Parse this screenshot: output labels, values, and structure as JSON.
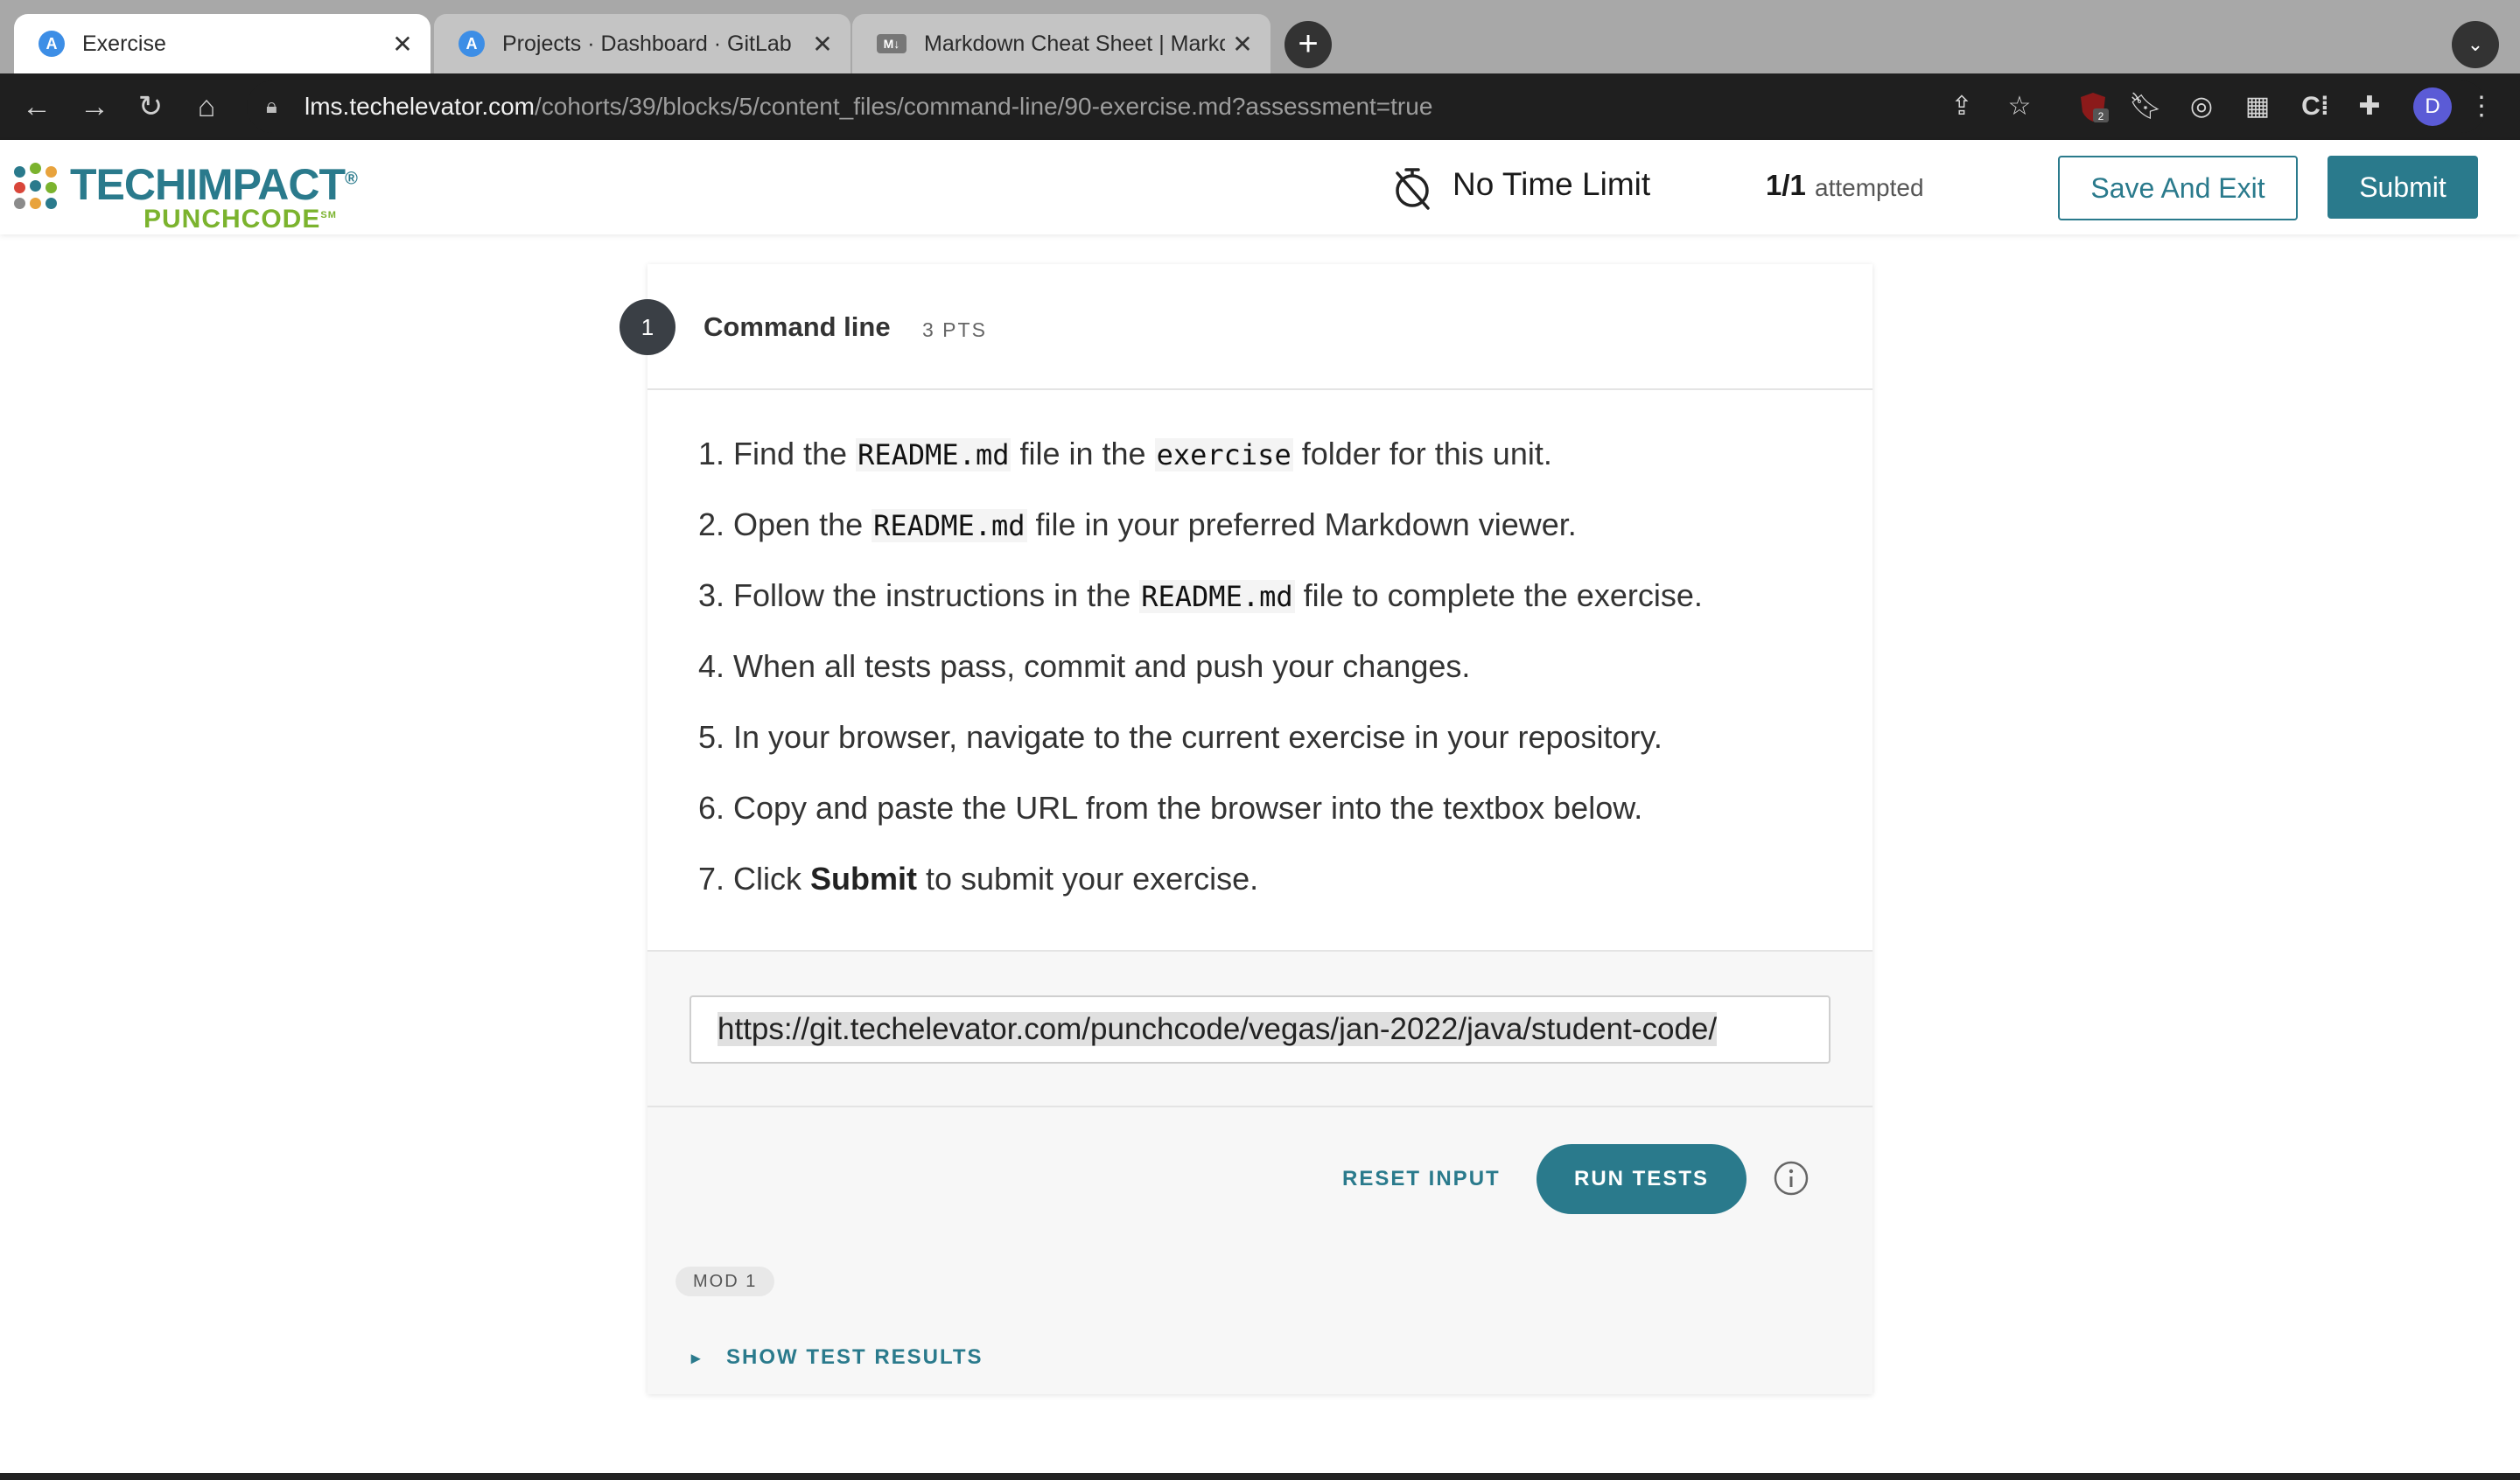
{
  "browser": {
    "tabs": [
      {
        "title": "Exercise",
        "favicon": "A",
        "active": true
      },
      {
        "title": "Projects · Dashboard · GitLab",
        "favicon": "A",
        "active": false
      },
      {
        "title": "Markdown Cheat Sheet | Markd",
        "favicon": "M↓",
        "active": false
      }
    ],
    "url": {
      "host": "lms.techelevator.com",
      "path": "/cohorts/39/blocks/5/content_files/command-line/90-exercise.md?assessment=true"
    },
    "profile_initial": "D",
    "extension_badge": "2"
  },
  "header": {
    "logo_line1": "TECHIMPACT",
    "logo_line1_mark": "®",
    "logo_line2": "PUNCHCODE",
    "logo_line2_mark": "SM",
    "time_limit": "No Time Limit",
    "attempt_count": "1/1",
    "attempt_label": "attempted",
    "save_exit_label": "Save And Exit",
    "submit_label": "Submit"
  },
  "question": {
    "number": "1",
    "title": "Command line",
    "points": "3 PTS",
    "steps": [
      {
        "num": "1.",
        "parts": [
          "Find the ",
          "README.md",
          " file in the ",
          "exercise",
          " folder for this unit."
        ]
      },
      {
        "num": "2.",
        "parts": [
          "Open the ",
          "README.md",
          " file in your preferred Markdown viewer."
        ]
      },
      {
        "num": "3.",
        "parts": [
          "Follow the instructions in the ",
          "README.md",
          " file to complete the exercise."
        ]
      },
      {
        "num": "4.",
        "parts": [
          "When all tests pass, commit and push your changes."
        ]
      },
      {
        "num": "5.",
        "parts": [
          "In your browser, navigate to the current exercise in your repository."
        ]
      },
      {
        "num": "6.",
        "parts": [
          "Copy and paste the URL from the browser into the textbox below."
        ]
      },
      {
        "num": "7.",
        "parts": [
          "Click ",
          "Submit",
          " to submit your exercise."
        ]
      }
    ]
  },
  "answer": {
    "input_value": "https://git.techelevator.com/punchcode/vegas/jan-2022/java/student-code/"
  },
  "actions": {
    "reset_label": "RESET INPUT",
    "run_label": "RUN TESTS",
    "mod_tag": "MOD 1",
    "show_results_label": "SHOW TEST RESULTS"
  },
  "colors": {
    "accent": "#2a7a8c",
    "logo_green": "#7bb32e",
    "badge_dark": "#3a3f45"
  }
}
